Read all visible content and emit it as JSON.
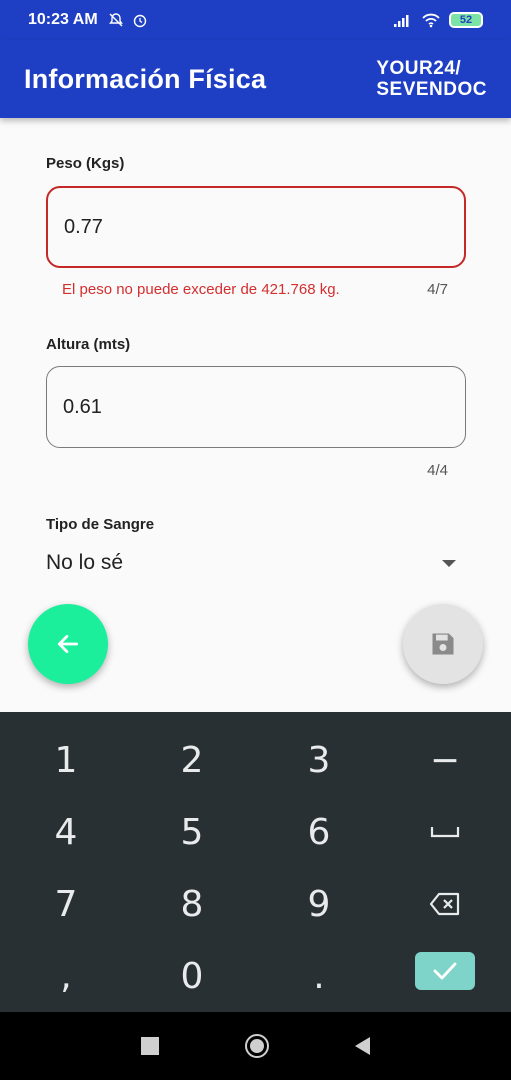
{
  "status_bar": {
    "time": "10:23 AM",
    "battery": "52"
  },
  "app_bar": {
    "title": "Información Física",
    "brand_line1": "YOUR24/",
    "brand_line2": "SEVENDOC"
  },
  "form": {
    "weight": {
      "label": "Peso (Kgs)",
      "value": "0.77",
      "error": "El peso no puede exceder de 421.768 kg.",
      "counter": "4/7"
    },
    "height": {
      "label": "Altura (mts)",
      "value": "0.61",
      "counter": "4/4"
    },
    "blood_type": {
      "label": "Tipo de Sangre",
      "value": "No lo sé"
    }
  },
  "keyboard": {
    "row1": [
      "1",
      "2",
      "3",
      "−"
    ],
    "row2": [
      "4",
      "5",
      "6",
      "␣"
    ],
    "row3": [
      "7",
      "8",
      "9",
      "⌫"
    ],
    "row4": [
      ",",
      "0",
      ".",
      "✓"
    ]
  },
  "colors": {
    "primary": "#1e3fc4",
    "error": "#d32f2f",
    "fab_back": "#1cef9c",
    "keyboard_bg": "#283034",
    "ok_key": "#7fd4c9"
  },
  "icons": {
    "back": "arrow-left-icon",
    "save": "floppy-disk-icon",
    "dropdown": "caret-down-icon"
  }
}
